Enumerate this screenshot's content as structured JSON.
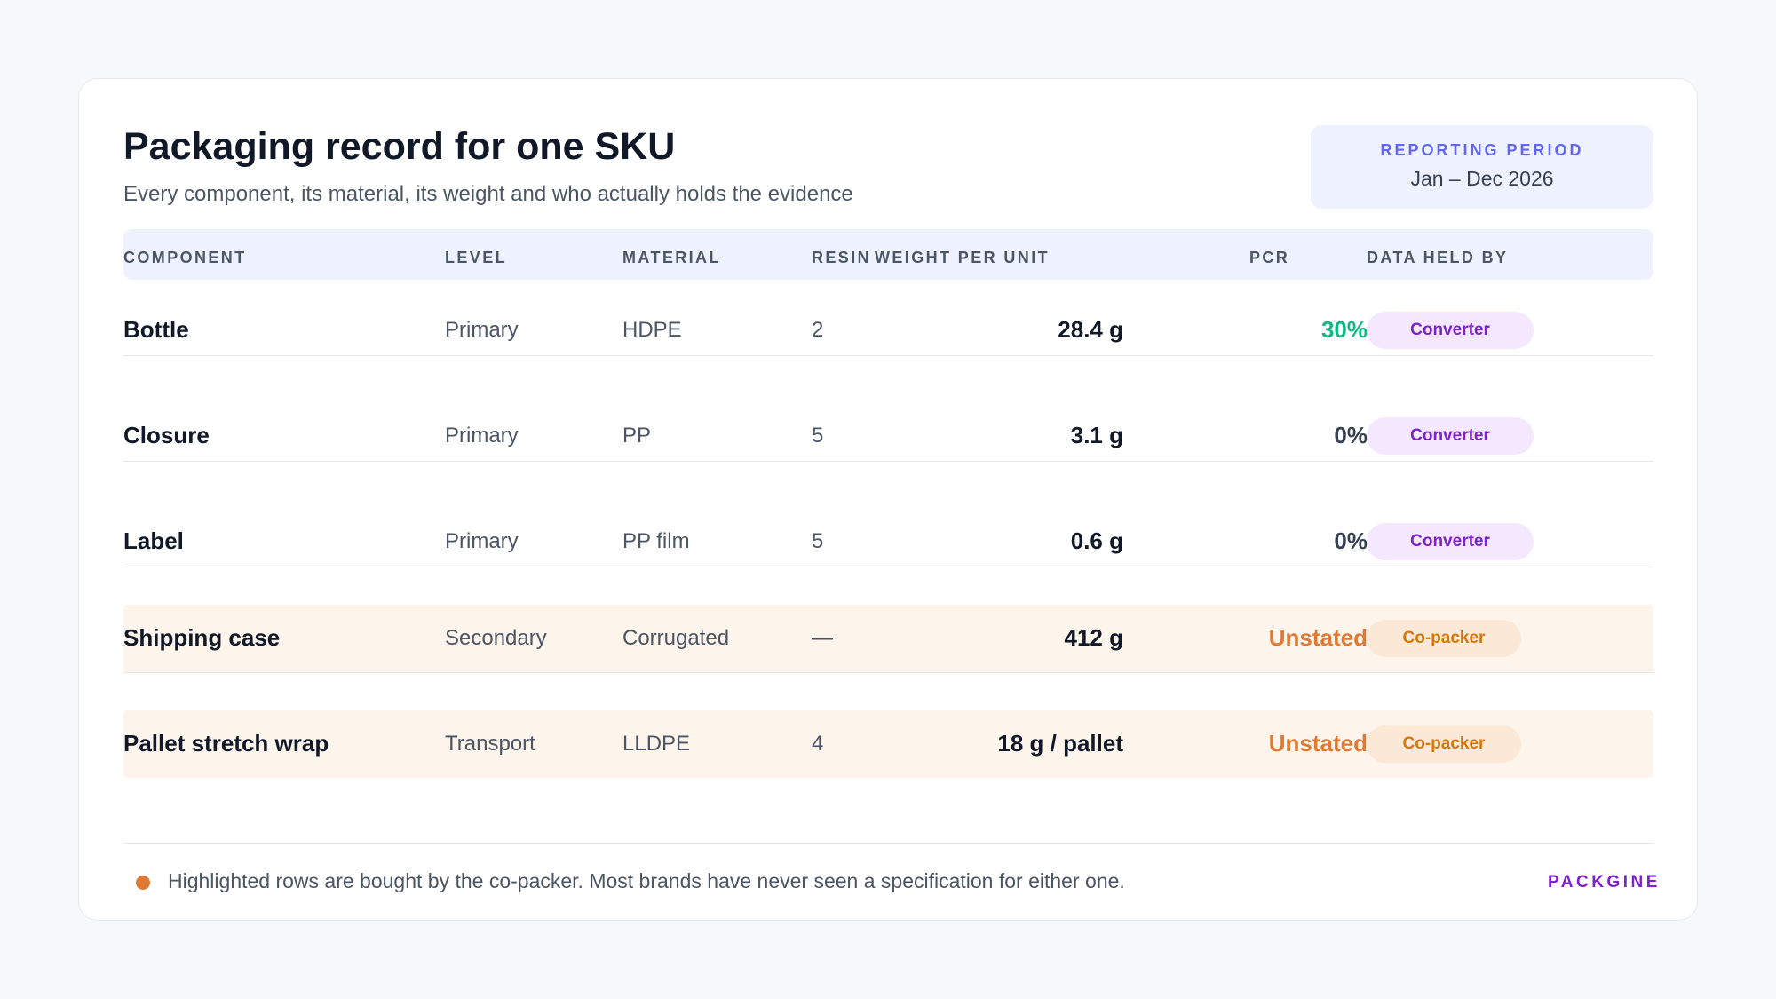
{
  "header": {
    "title": "Packaging record for one SKU",
    "subtitle": "Every component, its material, its weight and who actually holds the evidence"
  },
  "period": {
    "label": "REPORTING PERIOD",
    "value": "Jan – Dec 2026"
  },
  "table": {
    "columns": [
      "COMPONENT",
      "LEVEL",
      "MATERIAL",
      "RESIN",
      "WEIGHT PER UNIT",
      "PCR",
      "DATA HELD BY"
    ],
    "rows": [
      {
        "component": "Bottle",
        "level": "Primary",
        "material": "HDPE",
        "resin": "2",
        "weight": "28.4 g",
        "pcr": "30%",
        "held_by": "Converter"
      },
      {
        "component": "Closure",
        "level": "Primary",
        "material": "PP",
        "resin": "5",
        "weight": "3.1 g",
        "pcr": "0%",
        "held_by": "Converter"
      },
      {
        "component": "Label",
        "level": "Primary",
        "material": "PP film",
        "resin": "5",
        "weight": "0.6 g",
        "pcr": "0%",
        "held_by": "Converter"
      },
      {
        "component": "Shipping case",
        "level": "Secondary",
        "material": "Corrugated",
        "resin": "—",
        "weight": "412 g",
        "pcr": "Unstated",
        "held_by": "Co-packer"
      },
      {
        "component": "Pallet stretch wrap",
        "level": "Transport",
        "material": "LLDPE",
        "resin": "4",
        "weight": "18 g / pallet",
        "pcr": "Unstated",
        "held_by": "Co-packer"
      }
    ]
  },
  "colors": {
    "pcr_positive": "#10b981",
    "pcr_zero": "#374151",
    "pcr_unstated": "#dd7a35",
    "highlight_row": "#fdf4ec"
  },
  "footer": {
    "note": "Highlighted rows are bought by the co-packer. Most brands have never seen a specification for either one.",
    "brand": "PACKGINE"
  }
}
